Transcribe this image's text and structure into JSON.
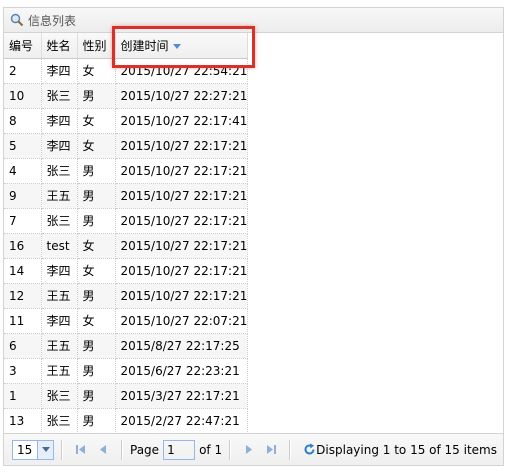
{
  "panel": {
    "title": "信息列表"
  },
  "columns": [
    "编号",
    "姓名",
    "性别",
    "创建时间"
  ],
  "rows": [
    [
      "2",
      "李四",
      "女",
      "2015/10/27 22:54:21"
    ],
    [
      "10",
      "张三",
      "男",
      "2015/10/27 22:27:21"
    ],
    [
      "8",
      "李四",
      "女",
      "2015/10/27 22:17:41"
    ],
    [
      "5",
      "李四",
      "女",
      "2015/10/27 22:17:21"
    ],
    [
      "4",
      "张三",
      "男",
      "2015/10/27 22:17:21"
    ],
    [
      "9",
      "王五",
      "男",
      "2015/10/27 22:17:21"
    ],
    [
      "7",
      "张三",
      "男",
      "2015/10/27 22:17:21"
    ],
    [
      "16",
      "test",
      "女",
      "2015/10/27 22:17:21"
    ],
    [
      "14",
      "李四",
      "女",
      "2015/10/27 22:17:21"
    ],
    [
      "12",
      "王五",
      "男",
      "2015/10/27 22:17:21"
    ],
    [
      "11",
      "李四",
      "女",
      "2015/10/27 22:07:21"
    ],
    [
      "6",
      "王五",
      "男",
      "2015/8/27 22:17:25"
    ],
    [
      "3",
      "王五",
      "男",
      "2015/6/27 22:23:21"
    ],
    [
      "1",
      "张三",
      "男",
      "2015/3/27 22:17:21"
    ],
    [
      "13",
      "张三",
      "男",
      "2015/2/27 22:47:21"
    ]
  ],
  "pager": {
    "page_size": "15",
    "page_label": "Page",
    "page_value": "1",
    "of_label": "of 1",
    "display_info": "Displaying 1 to 15 of 15 items"
  },
  "colors": {
    "highlight": "#d9302a",
    "accent": "#4c90d6"
  }
}
